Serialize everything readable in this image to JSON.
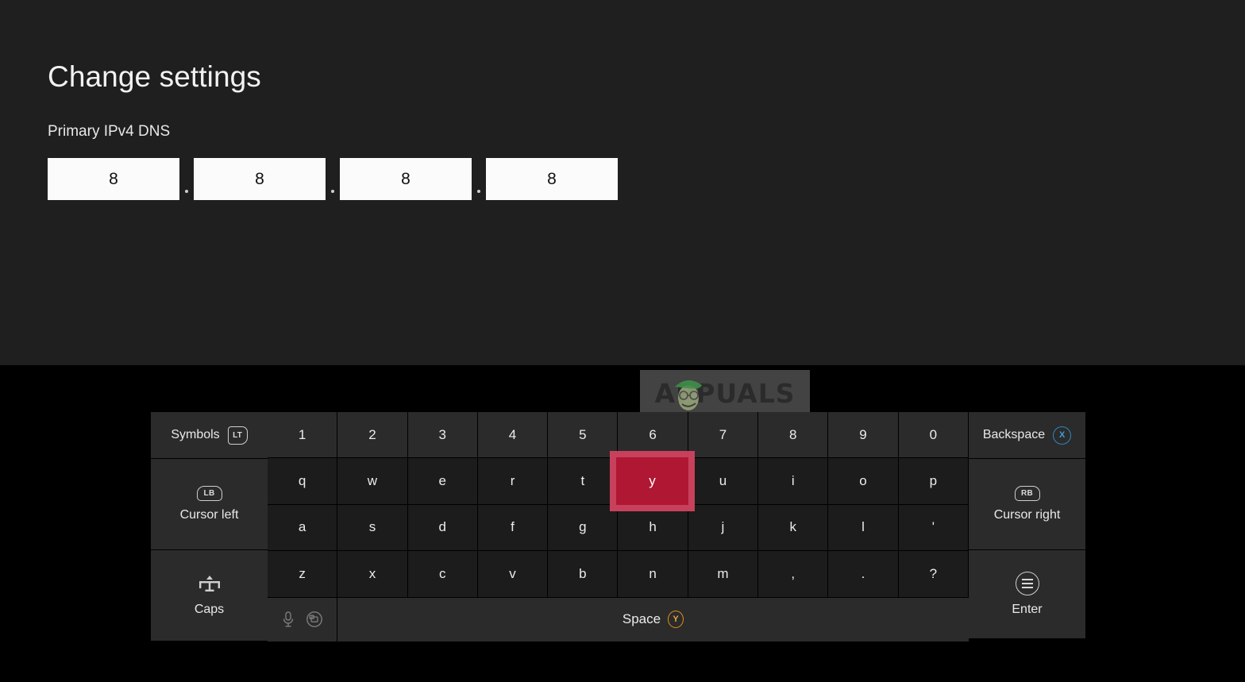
{
  "settings": {
    "title": "Change settings",
    "field_label": "Primary IPv4 DNS",
    "separator": ".",
    "octets": [
      "8",
      "8",
      "8",
      "8"
    ]
  },
  "watermark": {
    "text": "APPUALS"
  },
  "keyboard": {
    "selected_key": "y",
    "left": {
      "symbols_label": "Symbols",
      "symbols_button": "LT",
      "cursor_left_label": "Cursor left",
      "cursor_left_button": "LB",
      "caps_label": "Caps",
      "caps_icon": "caps-dpad-icon"
    },
    "right": {
      "backspace_label": "Backspace",
      "backspace_button": "X",
      "cursor_right_label": "Cursor right",
      "cursor_right_button": "RB",
      "enter_label": "Enter",
      "enter_icon": "menu-circle-icon"
    },
    "rows": [
      [
        "1",
        "2",
        "3",
        "4",
        "5",
        "6",
        "7",
        "8",
        "9",
        "0"
      ],
      [
        "q",
        "w",
        "e",
        "r",
        "t",
        "y",
        "u",
        "i",
        "o",
        "p"
      ],
      [
        "a",
        "s",
        "d",
        "f",
        "g",
        "h",
        "j",
        "k",
        "l",
        "'"
      ],
      [
        "z",
        "x",
        "c",
        "v",
        "b",
        "n",
        "m",
        ",",
        ".",
        "?"
      ]
    ],
    "space": {
      "label": "Space",
      "button": "Y",
      "mic_icon": "microphone-icon",
      "emoji_icon": "emoji-panel-icon"
    }
  },
  "colors": {
    "panel_bg": "#1f1f1f",
    "keyboard_bg": "#000000",
    "key_bg": "#2b2b2b",
    "selection_fill": "#b01733",
    "selection_border": "#c8415c",
    "x_button": "#2f87c0",
    "y_button": "#e09020",
    "input_bg": "#fbfbfb"
  }
}
